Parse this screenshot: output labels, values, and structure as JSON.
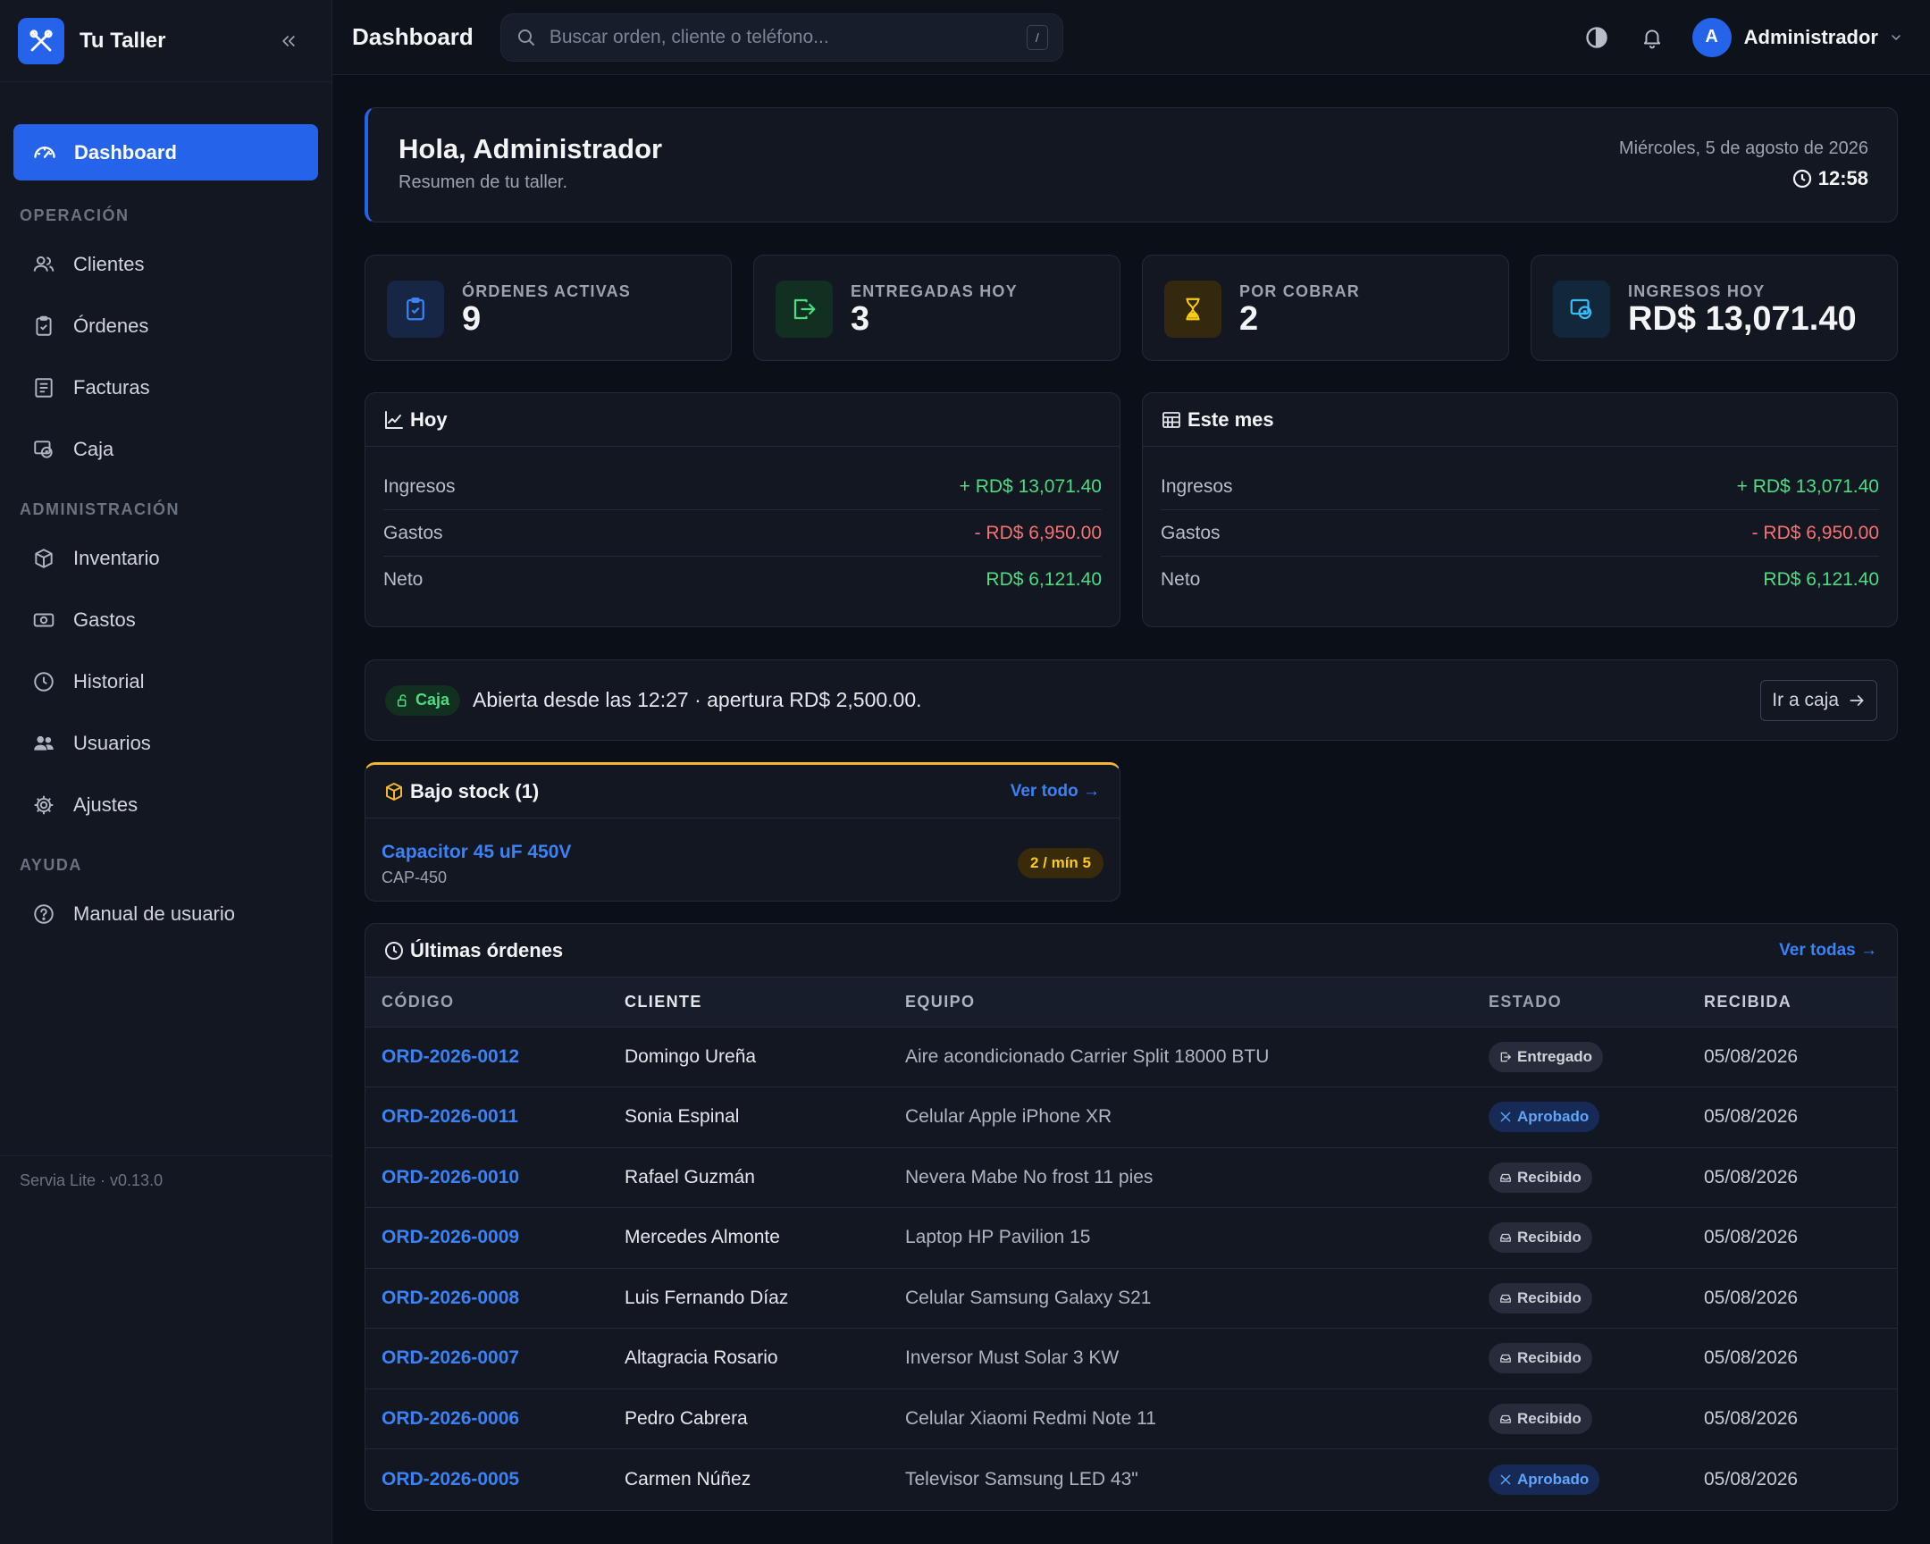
{
  "app": {
    "name": "Tu Taller",
    "version": "Servia Lite · v0.13.0"
  },
  "sidebar": {
    "active": "Dashboard",
    "sections": [
      {
        "title": "OPERACIÓN",
        "items": [
          "Clientes",
          "Órdenes",
          "Facturas",
          "Caja"
        ]
      },
      {
        "title": "ADMINISTRACIÓN",
        "items": [
          "Inventario",
          "Gastos",
          "Historial",
          "Usuarios",
          "Ajustes"
        ]
      },
      {
        "title": "AYUDA",
        "items": [
          "Manual de usuario"
        ]
      }
    ]
  },
  "topbar": {
    "title": "Dashboard",
    "search_placeholder": "Buscar orden, cliente o teléfono...",
    "search_shortcut": "/",
    "avatar_initial": "A",
    "user_name": "Administrador"
  },
  "welcome": {
    "greeting": "Hola, Administrador",
    "subtitle": "Resumen de tu taller.",
    "date": "Miércoles, 5 de agosto de 2026",
    "time": "12:58"
  },
  "stats": [
    {
      "label": "ÓRDENES ACTIVAS",
      "value": "9",
      "icon": "clipboard-check-icon",
      "color": "#3b82f6"
    },
    {
      "label": "ENTREGADAS HOY",
      "value": "3",
      "icon": "box-arrow-right-icon",
      "color": "#4ade80"
    },
    {
      "label": "POR COBRAR",
      "value": "2",
      "icon": "hourglass-icon",
      "color": "#facc15"
    },
    {
      "label": "INGRESOS HOY",
      "value": "RD$ 13,071.40",
      "icon": "cash-register-icon",
      "color": "#38bdf8"
    }
  ],
  "summary_today": {
    "title": "Hoy",
    "rows": [
      {
        "label": "Ingresos",
        "value": "+ RD$ 13,071.40"
      },
      {
        "label": "Gastos",
        "value": "- RD$ 6,950.00"
      },
      {
        "label": "Neto",
        "value": "RD$ 6,121.40"
      }
    ]
  },
  "summary_month": {
    "title": "Este mes",
    "rows": [
      {
        "label": "Ingresos",
        "value": "+ RD$ 13,071.40"
      },
      {
        "label": "Gastos",
        "value": "- RD$ 6,950.00"
      },
      {
        "label": "Neto",
        "value": "RD$ 6,121.40"
      }
    ]
  },
  "caja": {
    "badge": "Caja",
    "text": "Abierta desde las 12:27 · apertura RD$ 2,500.00.",
    "button": "Ir a caja"
  },
  "low_stock": {
    "title": "Bajo stock (1)",
    "link": "Ver todo →",
    "item": {
      "name": "Capacitor 45 uF 450V",
      "code": "CAP-450",
      "badge": "2 / mín 5"
    }
  },
  "orders": {
    "title": "Últimas órdenes",
    "link": "Ver todas →",
    "columns": [
      "CÓDIGO",
      "CLIENTE",
      "EQUIPO",
      "ESTADO",
      "RECIBIDA"
    ],
    "rows": [
      {
        "code": "ORD-2026-0012",
        "client": "Domingo Ureña",
        "equipment": "Aire acondicionado Carrier Split 18000 BTU",
        "status": "Entregado",
        "date": "05/08/2026"
      },
      {
        "code": "ORD-2026-0011",
        "client": "Sonia Espinal",
        "equipment": "Celular Apple iPhone XR",
        "status": "Aprobado",
        "date": "05/08/2026"
      },
      {
        "code": "ORD-2026-0010",
        "client": "Rafael Guzmán",
        "equipment": "Nevera Mabe No frost 11 pies",
        "status": "Recibido",
        "date": "05/08/2026"
      },
      {
        "code": "ORD-2026-0009",
        "client": "Mercedes Almonte",
        "equipment": "Laptop HP Pavilion 15",
        "status": "Recibido",
        "date": "05/08/2026"
      },
      {
        "code": "ORD-2026-0008",
        "client": "Luis Fernando Díaz",
        "equipment": "Celular Samsung Galaxy S21",
        "status": "Recibido",
        "date": "05/08/2026"
      },
      {
        "code": "ORD-2026-0007",
        "client": "Altagracia Rosario",
        "equipment": "Inversor Must Solar 3 KW",
        "status": "Recibido",
        "date": "05/08/2026"
      },
      {
        "code": "ORD-2026-0006",
        "client": "Pedro Cabrera",
        "equipment": "Celular Xiaomi Redmi Note 11",
        "status": "Recibido",
        "date": "05/08/2026"
      },
      {
        "code": "ORD-2026-0005",
        "client": "Carmen Núñez",
        "equipment": "Televisor Samsung LED 43\"",
        "status": "Aprobado",
        "date": "05/08/2026"
      }
    ]
  },
  "colors": {
    "accent": "#2563eb",
    "positive": "#4ade80",
    "negative": "#f87171",
    "warning": "#f5b733"
  }
}
